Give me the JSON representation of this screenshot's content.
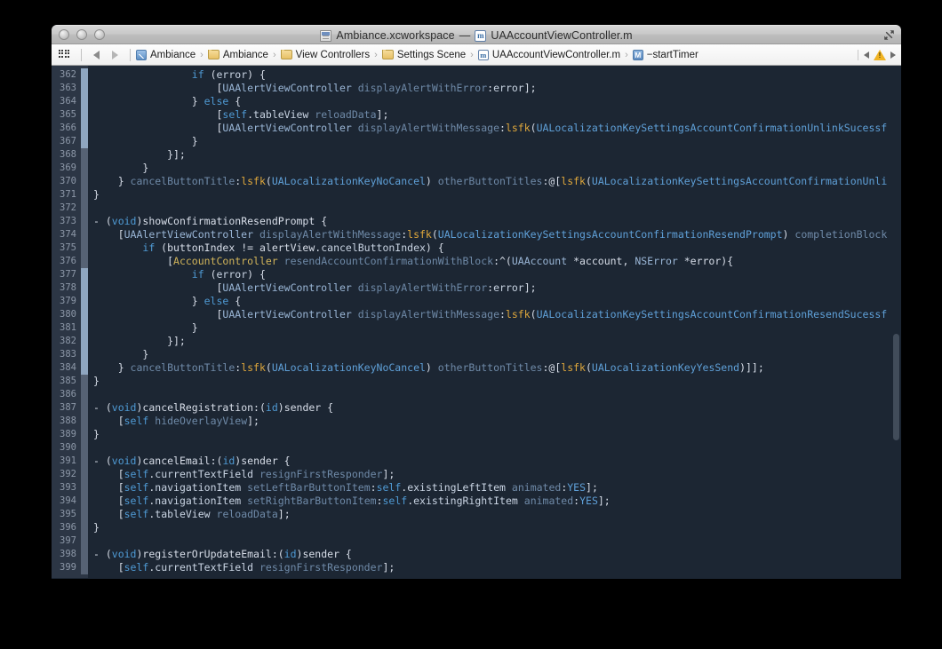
{
  "window": {
    "title": "Ambiance.xcworkspace",
    "title_separator": "—",
    "title_file": "UAAccountViewController.m",
    "workspace_icon": "xcode-workspace-icon",
    "file_icon": "objc-implementation-icon",
    "fullscreen_icon": "fullscreen-icon",
    "traffic_lights": [
      "close-button",
      "minimize-button",
      "zoom-button"
    ]
  },
  "toolbar": {
    "grid_icon": "related-items-icon",
    "back_icon": "back-arrow-icon",
    "forward_icon": "forward-arrow-icon",
    "breadcrumbs": [
      {
        "label": "Ambiance",
        "icon": "project-icon",
        "icon_type": "proj"
      },
      {
        "label": "Ambiance",
        "icon": "folder-icon",
        "icon_type": "folder"
      },
      {
        "label": "View Controllers",
        "icon": "folder-icon",
        "icon_type": "folder"
      },
      {
        "label": "Settings Scene",
        "icon": "folder-icon",
        "icon_type": "folder"
      },
      {
        "label": "UAAccountViewController.m",
        "icon": "objc-implementation-icon",
        "icon_type": "m"
      },
      {
        "label": "−startTimer",
        "icon": "method-symbol-icon",
        "icon_type": "M"
      }
    ],
    "separator": "›",
    "issue_prev_icon": "previous-issue-icon",
    "issue_warning_icon": "warning-triangle-icon",
    "issue_next_icon": "next-issue-icon"
  },
  "colors": {
    "editor_background": "#1c2633",
    "gutter_background": "#2c3645",
    "line_number": "#8d98a8",
    "change_bar": "#8fa6c0",
    "keyword": "#4f9ad4",
    "class_name": "#d1b45a",
    "macro": "#e0a83c",
    "selector": "#6f8aa8",
    "plain_text": "#d8dee9",
    "warning": "#f0b323",
    "desktop": "#000000"
  },
  "editor": {
    "first_line": 362,
    "last_line": 399,
    "lines": [
      {
        "n": 362,
        "change": true,
        "tokens": [
          [
            "plain",
            "                "
          ],
          [
            "kw",
            "if"
          ],
          [
            "plain",
            " ("
          ],
          [
            "prop",
            "error"
          ],
          [
            "plain",
            ") {"
          ]
        ]
      },
      {
        "n": 363,
        "change": true,
        "tokens": [
          [
            "plain",
            "                    ["
          ],
          [
            "type",
            "UAAlertViewController"
          ],
          [
            "plain",
            " "
          ],
          [
            "msg",
            "displayAlertWithError"
          ],
          [
            "plain",
            ":"
          ],
          [
            "prop",
            "error"
          ],
          [
            "plain",
            "];"
          ]
        ]
      },
      {
        "n": 364,
        "change": true,
        "tokens": [
          [
            "plain",
            "                } "
          ],
          [
            "kw",
            "else"
          ],
          [
            "plain",
            " {"
          ]
        ]
      },
      {
        "n": 365,
        "change": true,
        "tokens": [
          [
            "plain",
            "                    ["
          ],
          [
            "kw",
            "self"
          ],
          [
            "plain",
            "."
          ],
          [
            "prop",
            "tableView"
          ],
          [
            "plain",
            " "
          ],
          [
            "msg",
            "reloadData"
          ],
          [
            "plain",
            "];"
          ]
        ]
      },
      {
        "n": 366,
        "change": true,
        "tokens": [
          [
            "plain",
            "                    ["
          ],
          [
            "type",
            "UAAlertViewController"
          ],
          [
            "plain",
            " "
          ],
          [
            "msg",
            "displayAlertWithMessage"
          ],
          [
            "plain",
            ":"
          ],
          [
            "macro",
            "lsfk"
          ],
          [
            "plain",
            "("
          ],
          [
            "const",
            "UALocalizationKeySettingsAccountConfirmationUnlinkSucessf"
          ]
        ]
      },
      {
        "n": 367,
        "change": true,
        "tokens": [
          [
            "plain",
            "                }"
          ]
        ]
      },
      {
        "n": 368,
        "change": "dim",
        "tokens": [
          [
            "plain",
            "            }];"
          ]
        ]
      },
      {
        "n": 369,
        "change": "dim",
        "tokens": [
          [
            "plain",
            "        }"
          ]
        ]
      },
      {
        "n": 370,
        "change": "dim",
        "tokens": [
          [
            "plain",
            "    } "
          ],
          [
            "msg",
            "cancelButtonTitle"
          ],
          [
            "plain",
            ":"
          ],
          [
            "macro",
            "lsfk"
          ],
          [
            "plain",
            "("
          ],
          [
            "const",
            "UALocalizationKeyNoCancel"
          ],
          [
            "plain",
            ") "
          ],
          [
            "msg",
            "otherButtonTitles"
          ],
          [
            "plain",
            ":@["
          ],
          [
            "macro",
            "lsfk"
          ],
          [
            "plain",
            "("
          ],
          [
            "const",
            "UALocalizationKeySettingsAccountConfirmationUnli"
          ]
        ]
      },
      {
        "n": 371,
        "change": "dim",
        "tokens": [
          [
            "plain",
            "}"
          ]
        ]
      },
      {
        "n": 372,
        "change": "dim",
        "tokens": [
          [
            "plain",
            ""
          ]
        ]
      },
      {
        "n": 373,
        "change": "dim",
        "tokens": [
          [
            "plain",
            "- ("
          ],
          [
            "kw",
            "void"
          ],
          [
            "plain",
            ")"
          ],
          [
            "plain",
            "showConfirmationResendPrompt {"
          ]
        ]
      },
      {
        "n": 374,
        "change": "dim",
        "tokens": [
          [
            "plain",
            "    ["
          ],
          [
            "type",
            "UAAlertViewController"
          ],
          [
            "plain",
            " "
          ],
          [
            "msg",
            "displayAlertWithMessage"
          ],
          [
            "plain",
            ":"
          ],
          [
            "macro",
            "lsfk"
          ],
          [
            "plain",
            "("
          ],
          [
            "const",
            "UALocalizationKeySettingsAccountConfirmationResendPrompt"
          ],
          [
            "plain",
            ") "
          ],
          [
            "msg",
            "completionBlock"
          ]
        ]
      },
      {
        "n": 375,
        "change": "dim",
        "tokens": [
          [
            "plain",
            "        "
          ],
          [
            "kw",
            "if"
          ],
          [
            "plain",
            " ("
          ],
          [
            "plain",
            "buttonIndex != "
          ],
          [
            "plain",
            "alertView."
          ],
          [
            "prop",
            "cancelButtonIndex"
          ],
          [
            "plain",
            ") {"
          ]
        ]
      },
      {
        "n": 376,
        "change": "dim",
        "tokens": [
          [
            "plain",
            "            ["
          ],
          [
            "cls",
            "AccountController"
          ],
          [
            "plain",
            " "
          ],
          [
            "msg",
            "resendAccountConfirmationWithBlock"
          ],
          [
            "plain",
            ":^("
          ],
          [
            "type",
            "UAAccount"
          ],
          [
            "plain",
            " *account, "
          ],
          [
            "type",
            "NSError"
          ],
          [
            "plain",
            " *error){"
          ]
        ]
      },
      {
        "n": 377,
        "change": true,
        "tokens": [
          [
            "plain",
            "                "
          ],
          [
            "kw",
            "if"
          ],
          [
            "plain",
            " ("
          ],
          [
            "prop",
            "error"
          ],
          [
            "plain",
            ") {"
          ]
        ]
      },
      {
        "n": 378,
        "change": true,
        "tokens": [
          [
            "plain",
            "                    ["
          ],
          [
            "type",
            "UAAlertViewController"
          ],
          [
            "plain",
            " "
          ],
          [
            "msg",
            "displayAlertWithError"
          ],
          [
            "plain",
            ":"
          ],
          [
            "prop",
            "error"
          ],
          [
            "plain",
            "];"
          ]
        ]
      },
      {
        "n": 379,
        "change": true,
        "tokens": [
          [
            "plain",
            "                } "
          ],
          [
            "kw",
            "else"
          ],
          [
            "plain",
            " {"
          ]
        ]
      },
      {
        "n": 380,
        "change": true,
        "tokens": [
          [
            "plain",
            "                    ["
          ],
          [
            "type",
            "UAAlertViewController"
          ],
          [
            "plain",
            " "
          ],
          [
            "msg",
            "displayAlertWithMessage"
          ],
          [
            "plain",
            ":"
          ],
          [
            "macro",
            "lsfk"
          ],
          [
            "plain",
            "("
          ],
          [
            "const",
            "UALocalizationKeySettingsAccountConfirmationResendSucessf"
          ]
        ]
      },
      {
        "n": 381,
        "change": true,
        "tokens": [
          [
            "plain",
            "                }"
          ]
        ]
      },
      {
        "n": 382,
        "change": true,
        "tokens": [
          [
            "plain",
            "            }];"
          ]
        ]
      },
      {
        "n": 383,
        "change": true,
        "tokens": [
          [
            "plain",
            "        }"
          ]
        ]
      },
      {
        "n": 384,
        "change": true,
        "tokens": [
          [
            "plain",
            "    } "
          ],
          [
            "msg",
            "cancelButtonTitle"
          ],
          [
            "plain",
            ":"
          ],
          [
            "macro",
            "lsfk"
          ],
          [
            "plain",
            "("
          ],
          [
            "const",
            "UALocalizationKeyNoCancel"
          ],
          [
            "plain",
            ") "
          ],
          [
            "msg",
            "otherButtonTitles"
          ],
          [
            "plain",
            ":@["
          ],
          [
            "macro",
            "lsfk"
          ],
          [
            "plain",
            "("
          ],
          [
            "const",
            "UALocalizationKeyYesSend"
          ],
          [
            "plain",
            ")]];"
          ]
        ]
      },
      {
        "n": 385,
        "change": "dim",
        "tokens": [
          [
            "plain",
            "}"
          ]
        ]
      },
      {
        "n": 386,
        "change": "dim",
        "tokens": [
          [
            "plain",
            ""
          ]
        ]
      },
      {
        "n": 387,
        "change": "dim",
        "tokens": [
          [
            "plain",
            "- ("
          ],
          [
            "kw",
            "void"
          ],
          [
            "plain",
            ")"
          ],
          [
            "plain",
            "cancelRegistration:("
          ],
          [
            "kw",
            "id"
          ],
          [
            "plain",
            ")sender {"
          ]
        ]
      },
      {
        "n": 388,
        "change": "dim",
        "tokens": [
          [
            "plain",
            "    ["
          ],
          [
            "kw",
            "self"
          ],
          [
            "plain",
            " "
          ],
          [
            "msg",
            "hideOverlayView"
          ],
          [
            "plain",
            "];"
          ]
        ]
      },
      {
        "n": 389,
        "change": "dim",
        "tokens": [
          [
            "plain",
            "}"
          ]
        ]
      },
      {
        "n": 390,
        "change": "dim",
        "tokens": [
          [
            "plain",
            ""
          ]
        ]
      },
      {
        "n": 391,
        "change": "dim",
        "tokens": [
          [
            "plain",
            "- ("
          ],
          [
            "kw",
            "void"
          ],
          [
            "plain",
            ")"
          ],
          [
            "plain",
            "cancelEmail:("
          ],
          [
            "kw",
            "id"
          ],
          [
            "plain",
            ")sender {"
          ]
        ]
      },
      {
        "n": 392,
        "change": "dim",
        "tokens": [
          [
            "plain",
            "    ["
          ],
          [
            "kw",
            "self"
          ],
          [
            "plain",
            "."
          ],
          [
            "prop",
            "currentTextField"
          ],
          [
            "plain",
            " "
          ],
          [
            "msg",
            "resignFirstResponder"
          ],
          [
            "plain",
            "];"
          ]
        ]
      },
      {
        "n": 393,
        "change": "dim",
        "tokens": [
          [
            "plain",
            "    ["
          ],
          [
            "kw",
            "self"
          ],
          [
            "plain",
            "."
          ],
          [
            "prop",
            "navigationItem"
          ],
          [
            "plain",
            " "
          ],
          [
            "msg",
            "setLeftBarButtonItem"
          ],
          [
            "plain",
            ":"
          ],
          [
            "kw",
            "self"
          ],
          [
            "plain",
            "."
          ],
          [
            "prop",
            "existingLeftItem"
          ],
          [
            "plain",
            " "
          ],
          [
            "msg",
            "animated"
          ],
          [
            "plain",
            ":"
          ],
          [
            "const",
            "YES"
          ],
          [
            "plain",
            "];"
          ]
        ]
      },
      {
        "n": 394,
        "change": "dim",
        "tokens": [
          [
            "plain",
            "    ["
          ],
          [
            "kw",
            "self"
          ],
          [
            "plain",
            "."
          ],
          [
            "prop",
            "navigationItem"
          ],
          [
            "plain",
            " "
          ],
          [
            "msg",
            "setRightBarButtonItem"
          ],
          [
            "plain",
            ":"
          ],
          [
            "kw",
            "self"
          ],
          [
            "plain",
            "."
          ],
          [
            "prop",
            "existingRightItem"
          ],
          [
            "plain",
            " "
          ],
          [
            "msg",
            "animated"
          ],
          [
            "plain",
            ":"
          ],
          [
            "const",
            "YES"
          ],
          [
            "plain",
            "];"
          ]
        ]
      },
      {
        "n": 395,
        "change": "dim",
        "tokens": [
          [
            "plain",
            "    ["
          ],
          [
            "kw",
            "self"
          ],
          [
            "plain",
            "."
          ],
          [
            "prop",
            "tableView"
          ],
          [
            "plain",
            " "
          ],
          [
            "msg",
            "reloadData"
          ],
          [
            "plain",
            "];"
          ]
        ]
      },
      {
        "n": 396,
        "change": "dim",
        "tokens": [
          [
            "plain",
            "}"
          ]
        ]
      },
      {
        "n": 397,
        "change": "dim",
        "tokens": [
          [
            "plain",
            ""
          ]
        ]
      },
      {
        "n": 398,
        "change": "dim",
        "tokens": [
          [
            "plain",
            "- ("
          ],
          [
            "kw",
            "void"
          ],
          [
            "plain",
            ")"
          ],
          [
            "plain",
            "registerOrUpdateEmail:("
          ],
          [
            "kw",
            "id"
          ],
          [
            "plain",
            ")sender {"
          ]
        ]
      },
      {
        "n": 399,
        "change": "dim",
        "tokens": [
          [
            "plain",
            "    ["
          ],
          [
            "kw",
            "self"
          ],
          [
            "plain",
            "."
          ],
          [
            "prop",
            "currentTextField"
          ],
          [
            "plain",
            " "
          ],
          [
            "msg",
            "resignFirstResponder"
          ],
          [
            "plain",
            "];"
          ]
        ]
      }
    ]
  }
}
